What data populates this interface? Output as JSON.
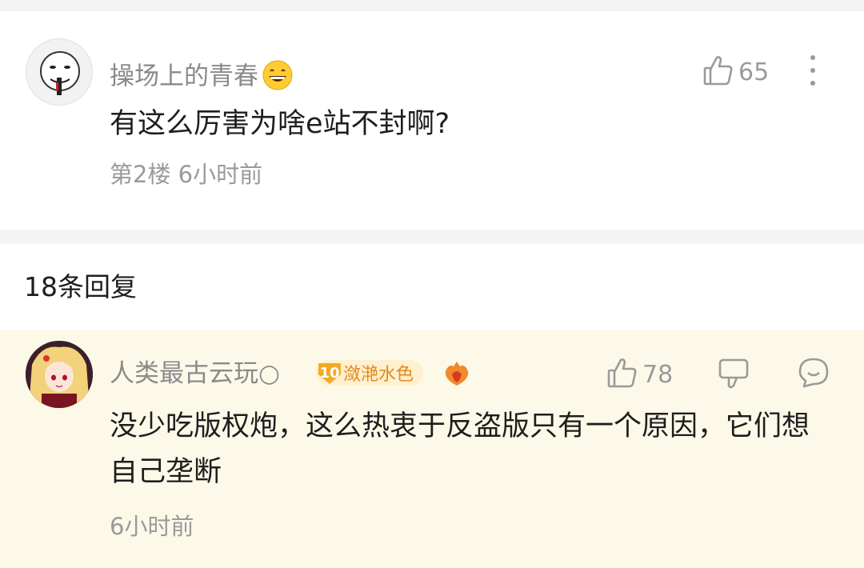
{
  "post": {
    "username": "操场上的青春",
    "emoji_icon": "grinning-face-emoji",
    "like_count": "65",
    "content": "有这么厉害为啥e站不封啊?",
    "meta": "第2楼 6小时前"
  },
  "replies_header": {
    "count_label": "18条回复"
  },
  "reply": {
    "username": "人类最古云玩○",
    "badge_level": "10",
    "badge_label": "潋滟水色",
    "like_count": "78",
    "content": "没少吃版权炮，这么热衷于反盗版只有一个原因，它们想自己垄断",
    "meta": "6小时前",
    "background_color": "#fdf9e8"
  },
  "colors": {
    "secondary_text": "#9a9a9a",
    "badge_text": "#e08a1e",
    "badge_bg": "#fff0cf"
  }
}
